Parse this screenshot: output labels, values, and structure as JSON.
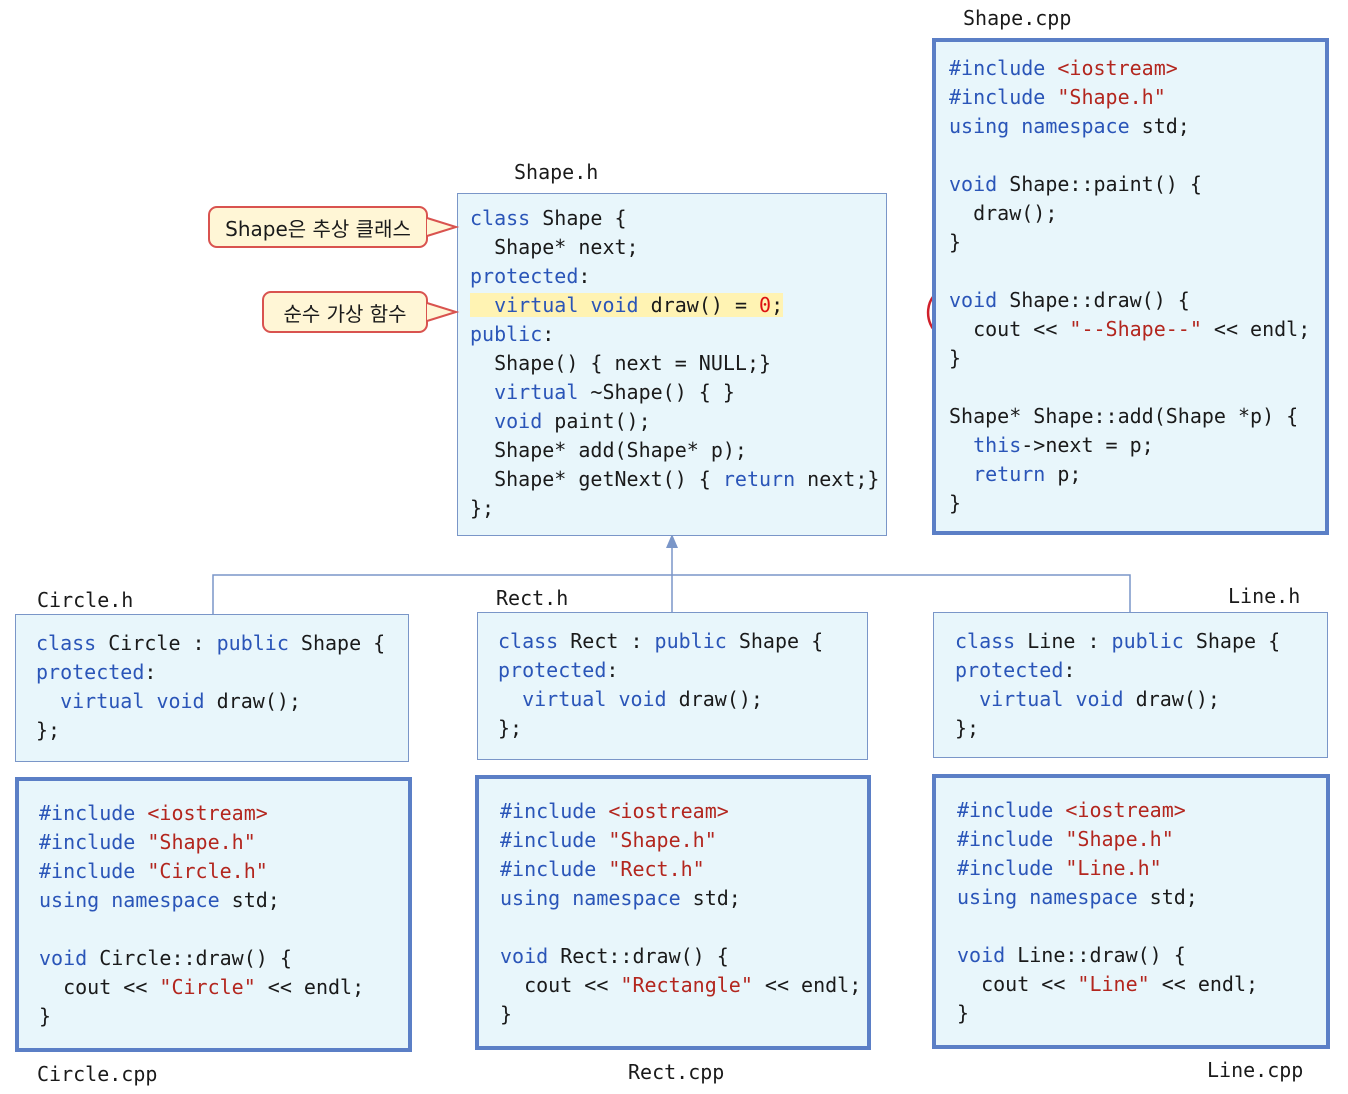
{
  "files": {
    "shape_h": "Shape.h",
    "shape_cpp": "Shape.cpp",
    "circle_h": "Circle.h",
    "rect_h": "Rect.h",
    "line_h": "Line.h",
    "circle_cpp": "Circle.cpp",
    "rect_cpp": "Rect.cpp",
    "line_cpp": "Line.cpp"
  },
  "callouts": {
    "abstract_class": "Shape은 추상 클래스",
    "pure_virtual": "순수 가상 함수"
  },
  "colors": {
    "keyword": "#2a55b8",
    "string": "#b3261e",
    "box_fill": "#e8f6fb",
    "box_border": "#5b7fc6",
    "callout_border": "#d9534f",
    "callout_fill": "#fff6d6",
    "cloud_outline": "#d0202a",
    "highlight": "#fff3b3"
  },
  "code": {
    "shape_h": [
      [
        [
          "kw",
          "class"
        ],
        [
          "plain",
          " Shape {"
        ]
      ],
      [
        [
          "plain",
          "  Shape* next;"
        ]
      ],
      [
        [
          "kw",
          "protected"
        ],
        [
          "plain",
          ":"
        ]
      ],
      [
        [
          "hl",
          "  "
        ],
        [
          "hl-kw",
          "virtual"
        ],
        [
          "hl",
          " "
        ],
        [
          "hl-kw",
          "void"
        ],
        [
          "hl",
          " draw() = "
        ],
        [
          "hl-num",
          "0"
        ],
        [
          "hl",
          ";"
        ]
      ],
      [
        [
          "kw",
          "public"
        ],
        [
          "plain",
          ":"
        ]
      ],
      [
        [
          "plain",
          "  Shape() { next = NULL;}"
        ]
      ],
      [
        [
          "plain",
          "  "
        ],
        [
          "kw",
          "virtual"
        ],
        [
          "plain",
          " ~Shape() { }"
        ]
      ],
      [
        [
          "plain",
          "  "
        ],
        [
          "kw",
          "void"
        ],
        [
          "plain",
          " paint();"
        ]
      ],
      [
        [
          "plain",
          "  Shape* add(Shape* p);"
        ]
      ],
      [
        [
          "plain",
          "  Shape* getNext() { "
        ],
        [
          "kw",
          "return"
        ],
        [
          "plain",
          " next;}"
        ]
      ],
      [
        [
          "plain",
          "};"
        ]
      ]
    ],
    "shape_cpp": [
      [
        [
          "kw",
          "#include"
        ],
        [
          "plain",
          " "
        ],
        [
          "str",
          "<iostream>"
        ]
      ],
      [
        [
          "kw",
          "#include"
        ],
        [
          "plain",
          " "
        ],
        [
          "str",
          "\"Shape.h\""
        ]
      ],
      [
        [
          "kw",
          "using"
        ],
        [
          "plain",
          " "
        ],
        [
          "kw",
          "namespace"
        ],
        [
          "plain",
          " std;"
        ]
      ],
      [
        [
          "plain",
          ""
        ]
      ],
      [
        [
          "kw",
          "void"
        ],
        [
          "plain",
          " Shape::paint() {"
        ]
      ],
      [
        [
          "plain",
          "  draw();"
        ]
      ],
      [
        [
          "plain",
          "}"
        ]
      ],
      [
        [
          "plain",
          ""
        ]
      ],
      [
        [
          "kw",
          "void"
        ],
        [
          "plain",
          " Shape::draw() {"
        ]
      ],
      [
        [
          "plain",
          "  cout << "
        ],
        [
          "str",
          "\"--Shape--\""
        ],
        [
          "plain",
          " << endl;"
        ]
      ],
      [
        [
          "plain",
          "}"
        ]
      ],
      [
        [
          "plain",
          ""
        ]
      ],
      [
        [
          "plain",
          "Shape* Shape::add(Shape *p) {"
        ]
      ],
      [
        [
          "plain",
          "  "
        ],
        [
          "kw",
          "this"
        ],
        [
          "plain",
          "->next = p;"
        ]
      ],
      [
        [
          "plain",
          "  "
        ],
        [
          "kw",
          "return"
        ],
        [
          "plain",
          " p;"
        ]
      ],
      [
        [
          "plain",
          "}"
        ]
      ]
    ],
    "circle_h": [
      [
        [
          "kw",
          "class"
        ],
        [
          "plain",
          " Circle : "
        ],
        [
          "kw",
          "public"
        ],
        [
          "plain",
          " Shape {"
        ]
      ],
      [
        [
          "kw",
          "protected"
        ],
        [
          "plain",
          ":"
        ]
      ],
      [
        [
          "plain",
          "  "
        ],
        [
          "kw",
          "virtual"
        ],
        [
          "plain",
          " "
        ],
        [
          "kw",
          "void"
        ],
        [
          "plain",
          " draw();"
        ]
      ],
      [
        [
          "plain",
          "};"
        ]
      ]
    ],
    "rect_h": [
      [
        [
          "kw",
          "class"
        ],
        [
          "plain",
          " Rect : "
        ],
        [
          "kw",
          "public"
        ],
        [
          "plain",
          " Shape {"
        ]
      ],
      [
        [
          "kw",
          "protected"
        ],
        [
          "plain",
          ":"
        ]
      ],
      [
        [
          "plain",
          "  "
        ],
        [
          "kw",
          "virtual"
        ],
        [
          "plain",
          " "
        ],
        [
          "kw",
          "void"
        ],
        [
          "plain",
          " draw();"
        ]
      ],
      [
        [
          "plain",
          "};"
        ]
      ]
    ],
    "line_h": [
      [
        [
          "kw",
          "class"
        ],
        [
          "plain",
          " Line : "
        ],
        [
          "kw",
          "public"
        ],
        [
          "plain",
          " Shape {"
        ]
      ],
      [
        [
          "kw",
          "protected"
        ],
        [
          "plain",
          ":"
        ]
      ],
      [
        [
          "plain",
          "  "
        ],
        [
          "kw",
          "virtual"
        ],
        [
          "plain",
          " "
        ],
        [
          "kw",
          "void"
        ],
        [
          "plain",
          " draw();"
        ]
      ],
      [
        [
          "plain",
          "};"
        ]
      ]
    ],
    "circle_cpp": [
      [
        [
          "kw",
          "#include"
        ],
        [
          "plain",
          " "
        ],
        [
          "str",
          "<iostream>"
        ]
      ],
      [
        [
          "kw",
          "#include"
        ],
        [
          "plain",
          " "
        ],
        [
          "str",
          "\"Shape.h\""
        ]
      ],
      [
        [
          "kw",
          "#include"
        ],
        [
          "plain",
          " "
        ],
        [
          "str",
          "\"Circle.h\""
        ]
      ],
      [
        [
          "kw",
          "using"
        ],
        [
          "plain",
          " "
        ],
        [
          "kw",
          "namespace"
        ],
        [
          "plain",
          " std;"
        ]
      ],
      [
        [
          "plain",
          ""
        ]
      ],
      [
        [
          "kw",
          "void"
        ],
        [
          "plain",
          " Circle::draw() {"
        ]
      ],
      [
        [
          "plain",
          "  cout << "
        ],
        [
          "str",
          "\"Circle\""
        ],
        [
          "plain",
          " << endl;"
        ]
      ],
      [
        [
          "plain",
          "}"
        ]
      ]
    ],
    "rect_cpp": [
      [
        [
          "kw",
          "#include"
        ],
        [
          "plain",
          " "
        ],
        [
          "str",
          "<iostream>"
        ]
      ],
      [
        [
          "kw",
          "#include"
        ],
        [
          "plain",
          " "
        ],
        [
          "str",
          "\"Shape.h\""
        ]
      ],
      [
        [
          "kw",
          "#include"
        ],
        [
          "plain",
          " "
        ],
        [
          "str",
          "\"Rect.h\""
        ]
      ],
      [
        [
          "kw",
          "using"
        ],
        [
          "plain",
          " "
        ],
        [
          "kw",
          "namespace"
        ],
        [
          "plain",
          " std;"
        ]
      ],
      [
        [
          "plain",
          ""
        ]
      ],
      [
        [
          "kw",
          "void"
        ],
        [
          "plain",
          " Rect::draw() {"
        ]
      ],
      [
        [
          "plain",
          "  cout << "
        ],
        [
          "str",
          "\"Rectangle\""
        ],
        [
          "plain",
          " << endl;"
        ]
      ],
      [
        [
          "plain",
          "}"
        ]
      ]
    ],
    "line_cpp": [
      [
        [
          "kw",
          "#include"
        ],
        [
          "plain",
          " "
        ],
        [
          "str",
          "<iostream>"
        ]
      ],
      [
        [
          "kw",
          "#include"
        ],
        [
          "plain",
          " "
        ],
        [
          "str",
          "\"Shape.h\""
        ]
      ],
      [
        [
          "kw",
          "#include"
        ],
        [
          "plain",
          " "
        ],
        [
          "str",
          "\"Line.h\""
        ]
      ],
      [
        [
          "kw",
          "using"
        ],
        [
          "plain",
          " "
        ],
        [
          "kw",
          "namespace"
        ],
        [
          "plain",
          " std;"
        ]
      ],
      [
        [
          "plain",
          ""
        ]
      ],
      [
        [
          "kw",
          "void"
        ],
        [
          "plain",
          " Line::draw() {"
        ]
      ],
      [
        [
          "plain",
          "  cout << "
        ],
        [
          "str",
          "\"Line\""
        ],
        [
          "plain",
          " << endl;"
        ]
      ],
      [
        [
          "plain",
          "}"
        ]
      ]
    ]
  }
}
